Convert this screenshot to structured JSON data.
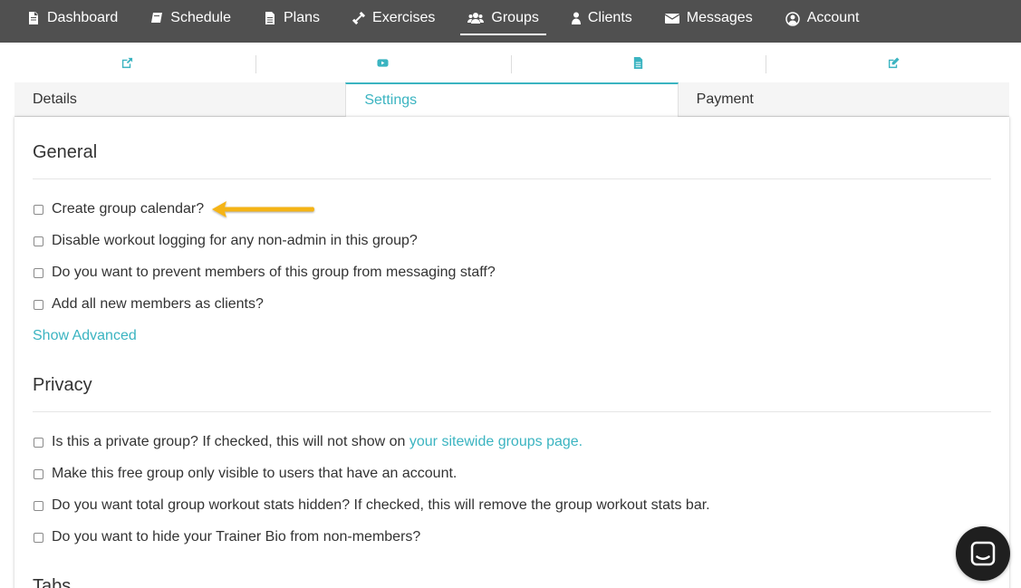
{
  "nav": {
    "items": [
      {
        "label": "Dashboard",
        "icon": "file-icon"
      },
      {
        "label": "Schedule",
        "icon": "book-icon"
      },
      {
        "label": "Plans",
        "icon": "file-text-icon"
      },
      {
        "label": "Exercises",
        "icon": "dumbbell-icon"
      },
      {
        "label": "Groups",
        "icon": "users-icon",
        "active": true
      },
      {
        "label": "Clients",
        "icon": "user-icon"
      },
      {
        "label": "Messages",
        "icon": "envelope-icon"
      },
      {
        "label": "Account",
        "icon": "user-circle-icon"
      }
    ]
  },
  "icon_tabs": [
    "external-link-icon",
    "youtube-play-icon",
    "document-icon",
    "edit-icon"
  ],
  "tabs": [
    {
      "label": "Details"
    },
    {
      "label": "Settings",
      "active": true
    },
    {
      "label": "Payment"
    }
  ],
  "general": {
    "title": "General",
    "options": [
      "Create group calendar?",
      "Disable workout logging for any non-admin in this group?",
      "Do you want to prevent members of this group from messaging staff?",
      "Add all new members as clients?"
    ],
    "show_advanced": "Show Advanced"
  },
  "privacy": {
    "title": "Privacy",
    "option1_text": "Is this a private group? If checked, this will not show on ",
    "option1_link": "your sitewide groups page.",
    "options": [
      "Make this free group only visible to users that have an account.",
      "Do you want total group workout stats hidden? If checked, this will remove the group workout stats bar.",
      "Do you want to hide your Trainer Bio from non-members?"
    ]
  },
  "tabs_section": {
    "title": "Tabs"
  },
  "colors": {
    "accent": "#3bb4c1",
    "nav_bg": "#505050",
    "arrow": "#f5b417",
    "chat_bg": "#1f1f1f"
  }
}
